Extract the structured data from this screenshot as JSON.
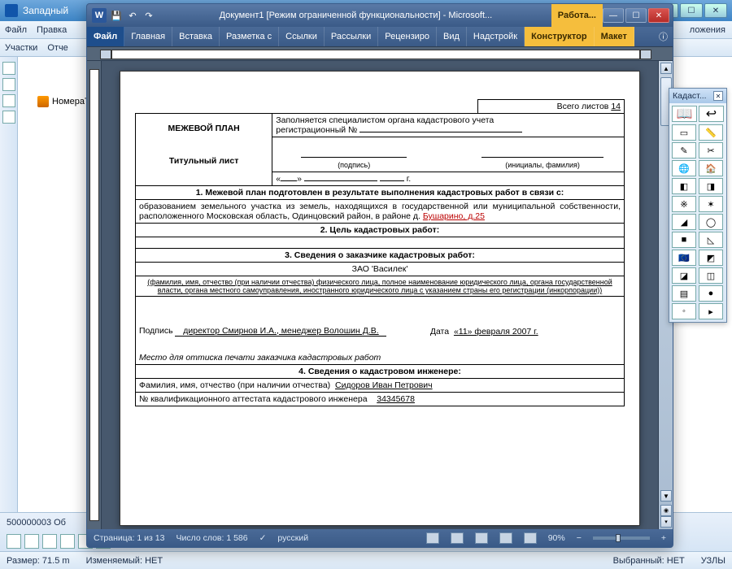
{
  "gis": {
    "title": "Западный",
    "menu1": [
      "Файл",
      "Правка"
    ],
    "menu2": [
      "Участки",
      "Отче"
    ],
    "tree_node": "НомераТс",
    "bottom_text": "500000003 Об",
    "status": {
      "size": "Размер: 71.5 m",
      "editable": "Изменяемый: НЕТ",
      "selected": "Выбранный: НЕТ",
      "nodes": "УЗЛЫ"
    },
    "sidebar_right_label": "ложения"
  },
  "word": {
    "title": "Документ1 [Режим ограниченной функциональности] - Microsoft...",
    "context_tab": "Работа...",
    "tabs": [
      "Файл",
      "Главная",
      "Вставка",
      "Разметка с",
      "Ссылки",
      "Рассылки",
      "Рецензиро",
      "Вид",
      "Надстройк",
      "Конструктор",
      "Макет"
    ],
    "status": {
      "page": "Страница: 1 из 13",
      "words": "Число слов: 1 586",
      "lang": "русский",
      "zoom": "90%"
    }
  },
  "panel": {
    "title": "Кадаст...",
    "icons": [
      "📖",
      "↩",
      "▭",
      "📏",
      "✎",
      "✂",
      "🌐",
      "🏠",
      "◧",
      "◨",
      "※",
      "✶",
      "◢",
      "◯",
      "■",
      "◺",
      "🇪🇺",
      "◩",
      "◪",
      "◫",
      "▤",
      "●",
      "◦",
      "▸"
    ]
  },
  "doc": {
    "total_sheets_label": "Всего листов",
    "total_sheets_value": "14",
    "filled_by": "Заполняется специалистом органа кадастрового учета",
    "reg_no": "регистрационный №",
    "title": "МЕЖЕВОЙ ПЛАН",
    "subtitle": "Титульный лист",
    "sig_label": "(подпись)",
    "initials_label": "(инициалы, фамилия)",
    "quote_open": "«",
    "quote_close": "»",
    "year_suffix": "г.",
    "sec1": "1. Межевой план подготовлен в результате выполнения кадастровых работ в связи с:",
    "sec1_body_a": "образованием земельного участка из земель, находящихся в государственной или муниципальной собственности, расположенного Московская область, Одинцовский район, в районе д. ",
    "sec1_body_b": "Бушарино, д.25",
    "sec2": "2. Цель кадастровых работ:",
    "sec3": "3. Сведения о заказчике кадастровых работ:",
    "customer": "ЗАО 'Василек'",
    "sec3_note": "(фамилия, имя, отчество (при наличии отчества) физического лица, полное наименование юридического лица, органа государственной власти, органа местного самоуправления, иностранного юридического лица с указанием страны его регистрации (инкорпорации))",
    "sign_label": "Подпись",
    "sign_text": "директор Смирнов И.А., менеджер Волошин Д.В.",
    "date_label": "Дата",
    "date_value": "«11» февраля 2007 г.",
    "stamp_note": "Место для оттиска печати заказчика кадастровых работ",
    "sec4": "4. Сведения о кадастровом инженере:",
    "sec4_fio_label": "Фамилия, имя, отчество (при наличии отчества)",
    "sec4_fio_value": "Сидоров Иван Петрович",
    "sec4_cert_label": "№ квалификационного аттестата кадастрового инженера",
    "sec4_cert_value": "34345678"
  }
}
